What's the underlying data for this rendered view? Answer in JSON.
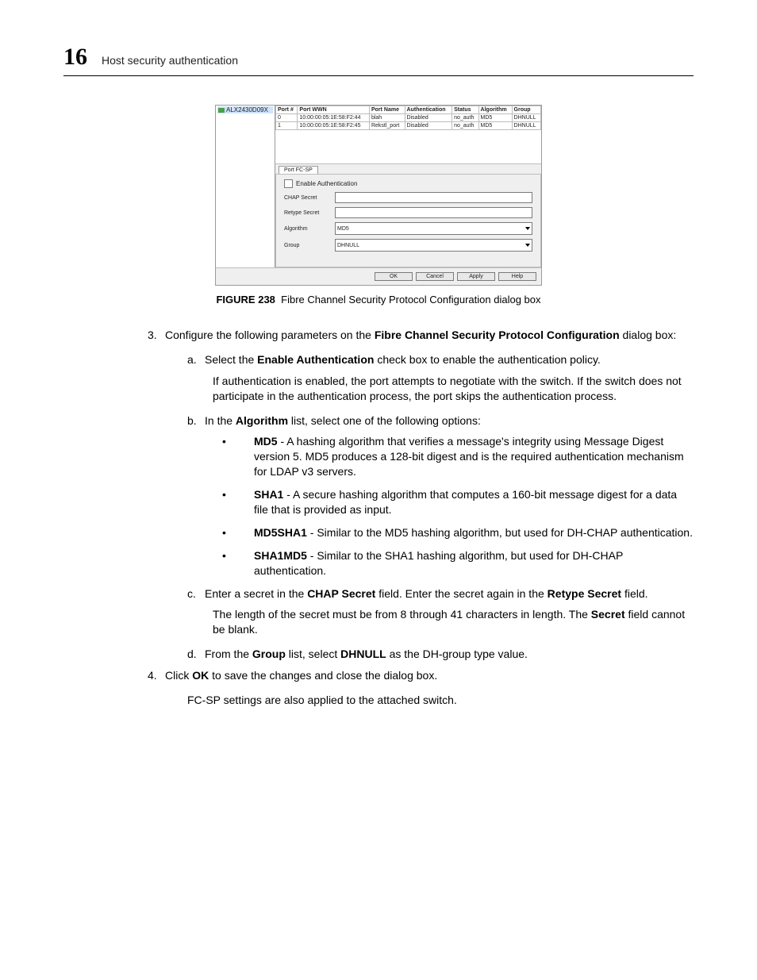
{
  "header": {
    "chapter": "16",
    "title": "Host security authentication"
  },
  "dialog": {
    "tree_node": "ALX2430D09X",
    "columns": [
      "Port #",
      "Port WWN",
      "Port Name",
      "Authentication",
      "Status",
      "Algorithm",
      "Group"
    ],
    "rows": [
      {
        "port": "0",
        "wwn": "10:00:00:05:1E:58:F2:44",
        "name": "blah",
        "auth": "Disabled",
        "status": "no_auth",
        "alg": "MD5",
        "group": "DHNULL"
      },
      {
        "port": "1",
        "wwn": "10:00:00:05:1E:58:F2:45",
        "name": "Rekstl_port",
        "auth": "Disabled",
        "status": "no_auth",
        "alg": "MD5",
        "group": "DHNULL"
      }
    ],
    "tab": "Port FC-SP",
    "enable_label": "Enable Authentication",
    "chap_label": "CHAP Secret",
    "retype_label": "Retype Secret",
    "algo_label": "Algorithm",
    "algo_value": "MD5",
    "group_label": "Group",
    "group_value": "DHNULL",
    "buttons": {
      "ok": "OK",
      "cancel": "Cancel",
      "apply": "Apply",
      "help": "Help"
    }
  },
  "figure": {
    "label": "FIGURE 238",
    "caption": "Fibre Channel Security Protocol Configuration dialog box"
  },
  "body": {
    "s3_num": "3.",
    "s3_a": "Configure the following parameters on the ",
    "s3_b": "Fibre Channel Security Protocol Configuration",
    "s3_c": " dialog box:",
    "a_num": "a.",
    "a_a": "Select the ",
    "a_b": "Enable Authentication",
    "a_c": " check box to enable the authentication policy.",
    "a_follow": "If authentication is enabled, the port attempts to negotiate with the switch. If the switch does not participate in the authentication process, the port skips the authentication process.",
    "b_num": "b.",
    "b_a": "In the ",
    "b_b": "Algorithm",
    "b_c": " list, select one of the following options:",
    "md5_b": "MD5",
    "md5_t": " - A hashing algorithm that verifies a message's integrity using Message Digest version 5. MD5 produces a 128-bit digest and is the required authentication mechanism for LDAP v3 servers.",
    "sha1_b": "SHA1",
    "sha1_t": " - A secure hashing algorithm that computes a 160-bit message digest for a data file that is provided as input.",
    "md5sha1_b": "MD5SHA1",
    "md5sha1_t": " - Similar to the MD5 hashing algorithm, but used for DH-CHAP authentication.",
    "sha1md5_b": "SHA1MD5",
    "sha1md5_t": " - Similar to the SHA1 hashing algorithm, but used for DH-CHAP authentication.",
    "c_num": "c.",
    "c_a": "Enter a secret in the ",
    "c_b": "CHAP Secret",
    "c_c": " field. Enter the secret again in the ",
    "c_d": "Retype Secret",
    "c_e": " field.",
    "c_f1": "The length of the secret must be from 8 through 41 characters in length. The ",
    "c_f2": "Secret",
    "c_f3": " field cannot be blank.",
    "d_num": "d.",
    "d_a": "From the ",
    "d_b": "Group",
    "d_c": " list, select ",
    "d_d": "DHNULL",
    "d_e": " as the DH-group type value.",
    "s4_num": "4.",
    "s4_a": "Click ",
    "s4_b": "OK",
    "s4_c": " to save the changes and close the dialog box.",
    "s4_follow": "FC-SP settings are also applied to the attached switch.",
    "bullet": "•"
  }
}
